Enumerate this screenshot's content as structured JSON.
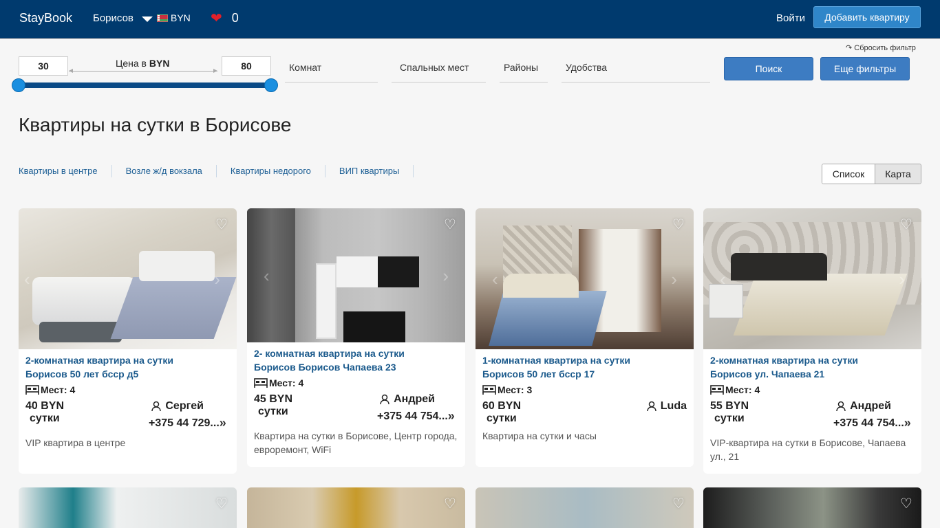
{
  "header": {
    "logo": "StayBook",
    "city": "Борисов",
    "currency": "BYN",
    "favorites_count": "0",
    "login": "Войти",
    "add_button": "Добавить квартиру"
  },
  "filters": {
    "reset": "↷ Сбросить фильтр",
    "price_min": "30",
    "price_max": "80",
    "price_label": "Цена в",
    "price_currency": "BYN",
    "rooms": "Комнат",
    "beds": "Спальных мест",
    "districts": "Районы",
    "amenities": "Удобства",
    "search_button": "Поиск",
    "more_filters_button": "Еще фильтры"
  },
  "page_title": "Квартиры на сутки в Борисове",
  "quick_links": [
    "Квартиры в центре",
    "Возле ж/д вокзала",
    "Квартиры недорого",
    "ВИП квартиры"
  ],
  "view_toggle": {
    "list": "Список",
    "map": "Карта"
  },
  "listings": [
    {
      "title_line1": "2-комнатная квартира на сутки",
      "title_line2": "Борисов 50 лет бсср д5",
      "places": "Мест: 4",
      "price": "40 BYN",
      "unit": "сутки",
      "owner": "Сергей",
      "phone": "+375 44 729...",
      "description": "VIP квартира в центре"
    },
    {
      "title_line1": "2- комнатная квартира на сутки",
      "title_line2": "Борисов Борисов Чапаева 23",
      "places": "Мест: 4",
      "price": "45 BYN",
      "unit": "сутки",
      "owner": "Андрей",
      "phone": "+375 44 754...",
      "description": "Квартира на сутки в Борисове, Центр города, евроремонт, WiFi"
    },
    {
      "title_line1": "1-комнатная квартира на сутки",
      "title_line2": "Борисов 50 лет бсср 17",
      "places": "Мест: 3",
      "price": "60 BYN",
      "unit": "сутки",
      "owner": "Luda",
      "phone": "",
      "description": "Квартира на сутки и часы"
    },
    {
      "title_line1": "2-комнатная квартира на сутки",
      "title_line2": "Борисов ул. Чапаева 21",
      "places": "Мест: 4",
      "price": "55 BYN",
      "unit": "сутки",
      "owner": "Андрей",
      "phone": "+375 44 754...",
      "description": "VIP-квартира на сутки в Борисове, Чапаева ул., 21"
    }
  ],
  "colors": {
    "header_bg": "#003a6e",
    "accent_button": "#2f86c9",
    "link": "#1b5a8c",
    "slider": "#0a4a86"
  }
}
